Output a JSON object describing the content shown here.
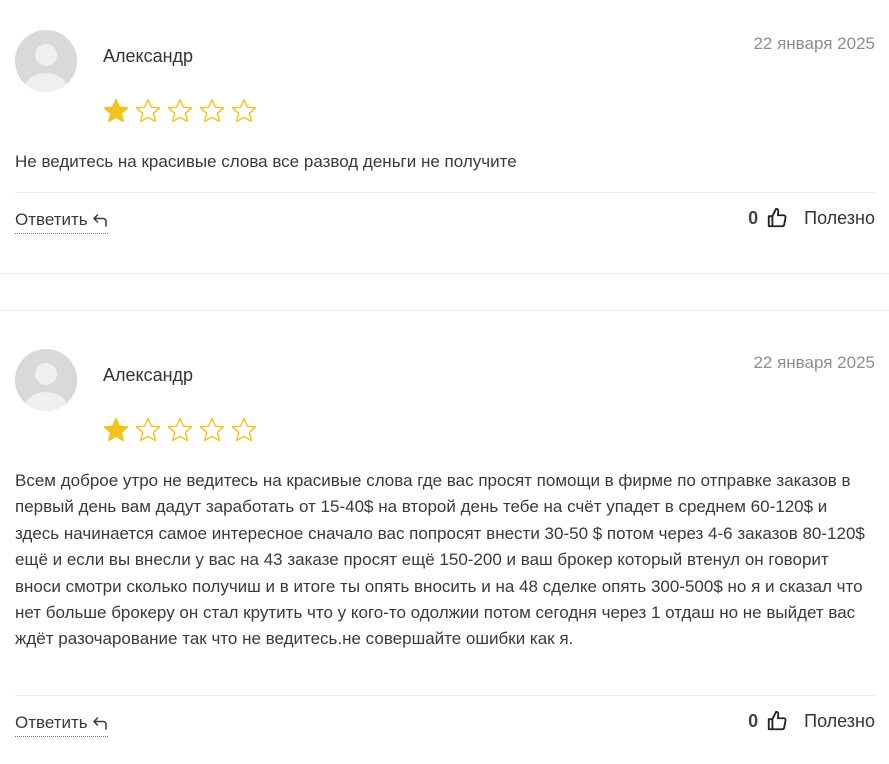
{
  "reviews": [
    {
      "author": "Александр",
      "date": "22 января 2025",
      "rating": 1,
      "max_rating": 5,
      "text": "Не ведитесь на красивые слова все развод деньги не получите",
      "reply_label": "Ответить",
      "helpful_count": "0",
      "helpful_label": "Полезно"
    },
    {
      "author": "Александр",
      "date": "22 января 2025",
      "rating": 1,
      "max_rating": 5,
      "text": "Всем доброе утро не ведитесь на красивые слова где вас просят помощи в фирме по отправке заказов в первый день вам дадут заработать от 15-40$ на второй день тебе на счёт упадет в среднем 60-120$ и здесь начинается самое интересное сначало вас попросят внести 30-50 $ потом через 4-6 заказов 80-120$ ещё и если вы внесли у вас на 43 заказе просят ещё 150-200 и ваш брокер который втенул он говорит вноси смотри сколько получиш и в итоге ты опять вносить и на 48 сделке опять 300-500$ но я и сказал что нет больше брокеру он стал крутить что у кого-то одолжии потом сегодня через 1 отдаш но не выйдет вас ждёт разочарование так что не ведитесь.не совершайте ошибки как я.",
      "reply_label": "Ответить",
      "helpful_count": "0",
      "helpful_label": "Полезно"
    }
  ],
  "colors": {
    "star_filled": "#f2c31c",
    "star_empty_stroke": "#f2c31c",
    "date": "#8d8d8d",
    "avatar_bg": "#d9d9d9"
  },
  "icons": [
    "user-avatar-icon",
    "star-filled-icon",
    "star-empty-icon",
    "reply-arrow-icon",
    "thumbs-up-icon"
  ]
}
